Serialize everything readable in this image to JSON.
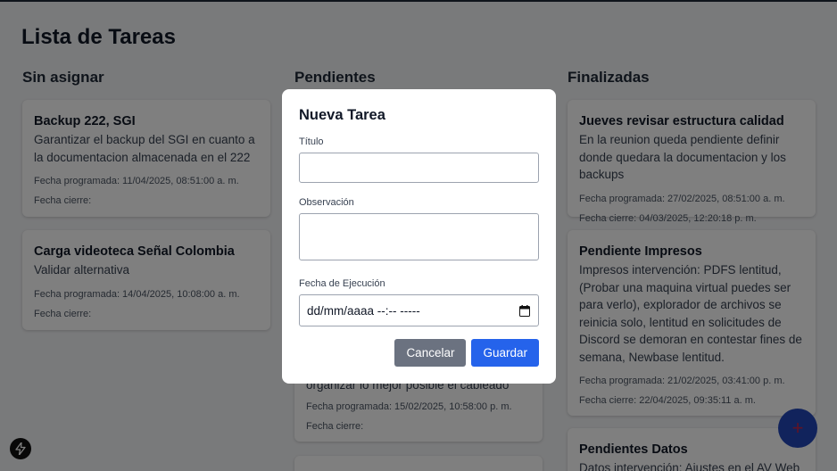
{
  "page": {
    "title": "Lista de Tareas"
  },
  "columns": [
    {
      "title": "Sin asignar",
      "cards": [
        {
          "title": "Backup 222, SGI",
          "desc": "Garantizar el backup del SGI en cuanto a la documentacion almacenada en el 222",
          "scheduled": "Fecha programada: 11/04/2025, 08:51:00 a. m.",
          "closed": "Fecha cierre:"
        },
        {
          "title": "Carga videoteca Señal Colombia",
          "desc": "Validar alternativa",
          "scheduled": "Fecha programada: 14/04/2025, 10:08:00 a. m.",
          "closed": "Fecha cierre:"
        }
      ]
    },
    {
      "title": "Pendientes",
      "cards": [
        {
          "desc": "organizar lo mejor posible el cableado",
          "scheduled": "Fecha programada: 15/02/2025, 10:58:00 p. m.",
          "closed": "Fecha cierre:"
        }
      ]
    },
    {
      "title": "Finalizadas",
      "cards": [
        {
          "title": "Jueves revisar estructura calidad",
          "desc": "En la reunion queda pendiente definir donde quedara la documentacion y los backups",
          "scheduled": "Fecha programada: 27/02/2025, 08:51:00 a. m.",
          "closed": "Fecha cierre: 04/03/2025, 12:20:18 p. m."
        },
        {
          "title": "Pendiente Impresos",
          "desc": "Impresos intervención: PDFS lentitud, (Probar una maquina virtual puedes ser para verlo), explorador de archivos se reinicia solo, lentitud en solicitudes de Discord se demoran en contestar fines de semana, Newbase lentitud.",
          "scheduled": "Fecha programada: 21/02/2025, 03:41:00 p. m.",
          "closed": "Fecha cierre: 22/04/2025, 09:35:11 a. m."
        },
        {
          "title": "Pendientes Datos",
          "desc": "Datos intervención: Ajustes en el AV Web"
        }
      ]
    }
  ],
  "modal": {
    "title": "Nueva Tarea",
    "title_label": "Título",
    "title_value": "",
    "observation_label": "Observación",
    "observation_value": "",
    "date_label": "Fecha de Ejecución",
    "date_value": "dd/mm/aaaa --:-- -----",
    "cancel_label": "Cancelar",
    "save_label": "Guardar"
  },
  "fab": {
    "icon": "plus-icon",
    "glyph": "+"
  },
  "devtools": {
    "icon": "bolt-icon"
  },
  "colors": {
    "primary": "#2563eb",
    "cancel": "#6b7280",
    "fab": "#2347b8",
    "overlay": "rgba(0,0,0,0.5)"
  }
}
